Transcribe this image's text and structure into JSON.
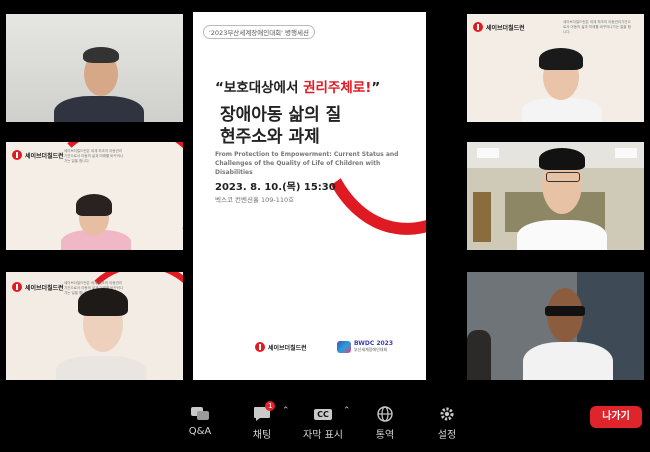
{
  "slide": {
    "event_tag": "'2023부산세계장애인대회' 병행세션",
    "subtitle_quote_open": "“보호대상에서 ",
    "subtitle_quote_red": "권리주체로!",
    "subtitle_quote_close": "”",
    "title_line1": "장애아동 삶의 질",
    "title_line2": "현주소와 과제",
    "english_title": "From Protection to Empowerment: Current Status and Challenges of the Quality of Life of Children with Disabilities",
    "date": "2023. 8. 10.(목) 15:30",
    "venue": "벡스코 컨벤션홀 109-110호",
    "org_logo": "세이브더칠드런",
    "partner_logo": "BWDC 2023",
    "partner_sub": "부산세계장애인대회"
  },
  "tiles": {
    "logo_text": "세이브더칠드런",
    "info_text": "세이브더칠드런은 세계 최초의 아동권리기관으로서 아동의 삶과 미래를 바꾸어나가는 일을 합니다."
  },
  "toolbar": {
    "qa_label": "Q&A",
    "chat_label": "채팅",
    "chat_badge": "1",
    "caption_label": "자막 표시",
    "caption_icon_text": "CC",
    "translate_label": "통역",
    "settings_label": "설정",
    "leave_label": "나가기"
  },
  "colors": {
    "brand_red": "#e01a22",
    "leave_red": "#e0242c",
    "toolbar_bg": "#000000"
  }
}
